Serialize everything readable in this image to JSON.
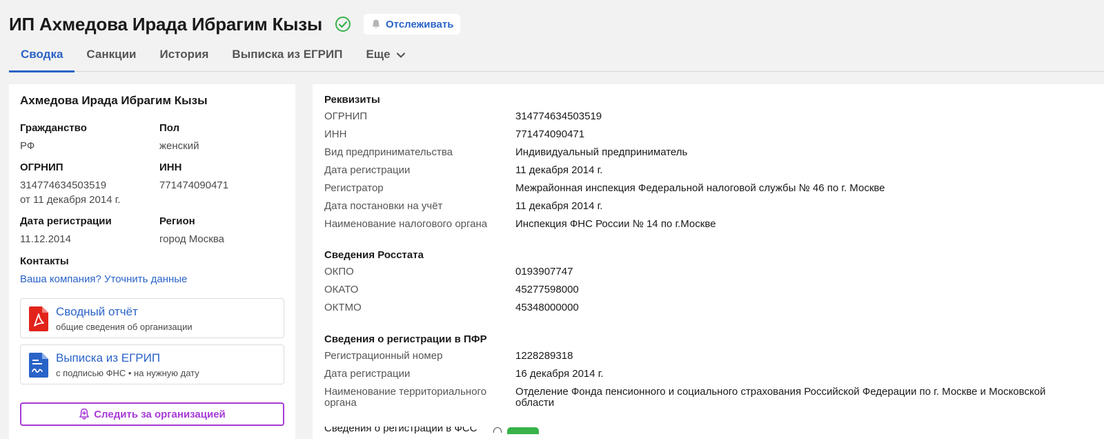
{
  "header": {
    "title": "ИП Ахмедова Ирада Ибрагим Кызы",
    "follow_label": "Отслеживать"
  },
  "tabs": [
    {
      "label": "Сводка",
      "active": true
    },
    {
      "label": "Санкции"
    },
    {
      "label": "История"
    },
    {
      "label": "Выписка из ЕГРИП"
    },
    {
      "label": "Еще"
    }
  ],
  "left": {
    "name": "Ахмедова Ирада Ибрагим Кызы",
    "citizenship_label": "Гражданство",
    "citizenship_value": "РФ",
    "gender_label": "Пол",
    "gender_value": "женский",
    "ogrnip_label": "ОГРНИП",
    "ogrnip_value": "314774634503519",
    "ogrnip_date": "от 11 декабря 2014 г.",
    "inn_label": "ИНН",
    "inn_value": "771474090471",
    "regdate_label": "Дата регистрации",
    "regdate_value": "11.12.2014",
    "region_label": "Регион",
    "region_value": "город Москва",
    "contacts_label": "Контакты",
    "contacts_link": "Ваша компания? Уточнить данные",
    "report": {
      "title": "Сводный отчёт",
      "subtitle": "общие сведения об организации"
    },
    "extract": {
      "title": "Выписка из ЕГРИП",
      "subtitle": "с подписью ФНС • на нужную дату"
    },
    "watch_label": "Следить за организацией"
  },
  "right": {
    "requisites_title": "Реквизиты",
    "requisites": [
      {
        "label": "ОГРНИП",
        "value": "314774634503519"
      },
      {
        "label": "ИНН",
        "value": "771474090471"
      },
      {
        "label": "Вид предпринимательства",
        "value": "Индивидуальный предприниматель"
      },
      {
        "label": "Дата регистрации",
        "value": "11 декабря 2014 г."
      },
      {
        "label": "Регистратор",
        "value": "Межрайонная инспекция Федеральной налоговой службы № 46 по г. Москве"
      },
      {
        "label": "Дата постановки на учёт",
        "value": "11 декабря 2014 г."
      },
      {
        "label": "Наименование налогового органа",
        "value": "Инспекция ФНС России № 14 по г.Москве"
      }
    ],
    "rosstat_title": "Сведения Росстата",
    "rosstat": [
      {
        "label": "ОКПО",
        "value": "0193907747"
      },
      {
        "label": "ОКАТО",
        "value": "45277598000"
      },
      {
        "label": "ОКТМО",
        "value": "45348000000"
      }
    ],
    "pfr_title": "Сведения о регистрации в ПФР",
    "pfr": [
      {
        "label": "Регистрационный номер",
        "value": "1228289318"
      },
      {
        "label": "Дата регистрации",
        "value": "16 декабря 2014 г."
      },
      {
        "label_line1": "Наименование территориального",
        "label_line2": "органа",
        "value_line1": "Отделение Фонда пенсионного и социального страхования Российской Федерации по г. Москве и Московской",
        "value_line2": "области"
      }
    ],
    "cut_off_text": "Сведения о регистрации в ФСС"
  },
  "colors": {
    "accent_blue": "#2a63c8",
    "accent_purple": "#a63ad6",
    "verified_green": "#37b34a",
    "pdf_red": "#e2231a"
  }
}
